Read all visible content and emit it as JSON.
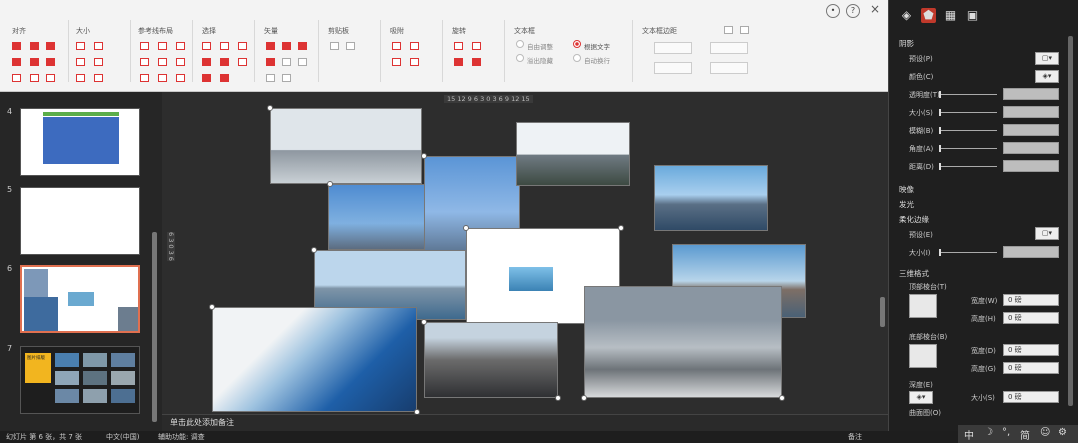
{
  "toolbar": {
    "groups": [
      "对齐",
      "大小",
      "参考线布局",
      "选择",
      "矢量",
      "剪贴板",
      "吸附",
      "旋转",
      "文本框",
      "文本框边距"
    ],
    "textbox_options": [
      "自由调整",
      "溢出隐藏",
      "根据文字",
      "自动换行"
    ],
    "help": "?",
    "close": "×"
  },
  "slides": {
    "numbers": [
      "4",
      "5",
      "6",
      "7"
    ],
    "slide7_title": "图片排版"
  },
  "ruler": {
    "ticks": "15 12 9 6 3 0 3 6 9 12 15",
    "vticks": "6 3 0 3 6"
  },
  "notes": {
    "placeholder": "单击此处添加备注"
  },
  "panel": {
    "sections": {
      "shadow": "阴影",
      "reflection": "映像",
      "glow": "发光",
      "soft_edge": "柔化边缘",
      "format3d": "三维格式"
    },
    "labels": {
      "preset": "预设(P)",
      "color": "颜色(C)",
      "transparency": "透明度(T)",
      "size": "大小(S)",
      "blur": "模糊(B)",
      "angle": "角度(A)",
      "distance": "距离(D)",
      "preset2": "预设(E)",
      "size2": "大小(I)",
      "top_bevel": "顶部棱台(T)",
      "width1": "宽度(W)",
      "height1": "高度(H)",
      "bottom_bevel": "底部棱台(B)",
      "width2": "宽度(D)",
      "height2": "高度(G)",
      "depth": "深度(E)",
      "depth_size": "大小(S)",
      "contour": "曲面图(O)"
    },
    "values": {
      "w1": "0 磅",
      "h1": "0 磅",
      "w2": "0 磅",
      "h2": "0 磅",
      "dsize": "0 磅"
    }
  },
  "status": {
    "slide_info": "幻灯片 第 6 张，共 7 张",
    "lang": "中文(中国)",
    "access": "辅助功能: 调查",
    "notes_btn": "备注"
  },
  "ime": {
    "chars": [
      "中",
      "☽",
      "°,",
      "简",
      "☺",
      "⚙"
    ]
  }
}
